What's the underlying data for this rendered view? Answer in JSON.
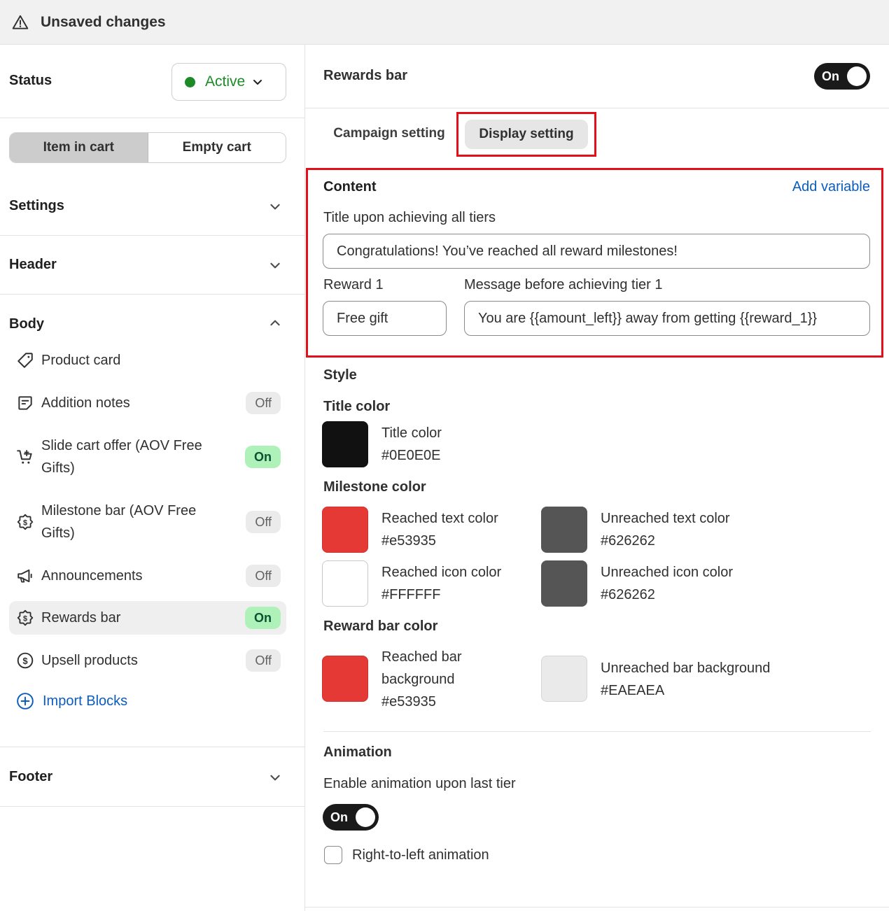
{
  "topbar": {
    "title": "Unsaved changes",
    "icon": "warning-icon"
  },
  "sidebar": {
    "status_label": "Status",
    "status_value": "Active",
    "status_color": "#1c8b27",
    "cart_tabs": [
      "Item in cart",
      "Empty cart"
    ],
    "sections": {
      "settings": "Settings",
      "header": "Header",
      "body": "Body",
      "footer": "Footer"
    },
    "body_items": [
      {
        "label": "Product card",
        "toggle": "",
        "icon": "tag-icon"
      },
      {
        "label": "Addition notes",
        "toggle": "Off",
        "icon": "note-icon"
      },
      {
        "label": "Slide cart offer (AOV Free Gifts)",
        "toggle": "On",
        "icon": "cart-gift-icon"
      },
      {
        "label": "Milestone bar (AOV Free Gifts)",
        "toggle": "Off",
        "icon": "badge-dollar-icon"
      },
      {
        "label": "Announcements",
        "toggle": "Off",
        "icon": "megaphone-icon"
      },
      {
        "label": "Rewards bar",
        "toggle": "On",
        "icon": "badge-dollar-icon"
      },
      {
        "label": "Upsell products",
        "toggle": "Off",
        "icon": "dollar-circle-icon"
      }
    ],
    "import_label": "Import Blocks"
  },
  "main": {
    "title": "Rewards bar",
    "enabled_label": "On",
    "tabs": [
      "Campaign setting",
      "Display setting"
    ],
    "content": {
      "heading": "Content",
      "add_variable": "Add variable",
      "title_label": "Title upon achieving all tiers",
      "title_value": "Congratulations! You’ve reached all reward milestones!",
      "reward_label": "Reward 1",
      "reward_value": "Free gift",
      "message_label": "Message before achieving tier 1",
      "message_value": "You are {{amount_left}} away from getting {{reward_1}}"
    },
    "style": {
      "heading": "Style",
      "title_color_heading": "Title color",
      "title_color": {
        "label": "Title color",
        "value": "#0E0E0E"
      },
      "milestone_heading": "Milestone color",
      "reached_text": {
        "label": "Reached text color",
        "value": "#e53935"
      },
      "unreached_text": {
        "label": "Unreached text color",
        "value": "#626262"
      },
      "reached_icon": {
        "label": "Reached icon color",
        "value": "#FFFFFF"
      },
      "unreached_icon": {
        "label": "Unreached icon color",
        "value": "#626262"
      },
      "bar_heading": "Reward bar color",
      "reached_bar": {
        "label_1": "Reached bar",
        "label_2": "background",
        "value": "#e53935"
      },
      "unreached_bar": {
        "label": "Unreached bar background",
        "value": "#EAEAEA"
      }
    },
    "animation": {
      "heading": "Animation",
      "enable_label": "Enable animation upon last tier",
      "enable_state": "On",
      "rtl_label": "Right-to-left animation"
    }
  }
}
